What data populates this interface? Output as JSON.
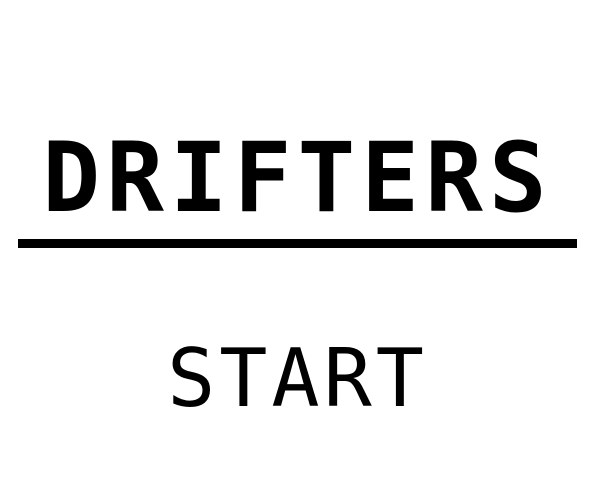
{
  "game": {
    "title": "DRIFTERS",
    "menu_start": "START"
  },
  "colors": {
    "background": "#ffffff",
    "foreground": "#000000"
  }
}
